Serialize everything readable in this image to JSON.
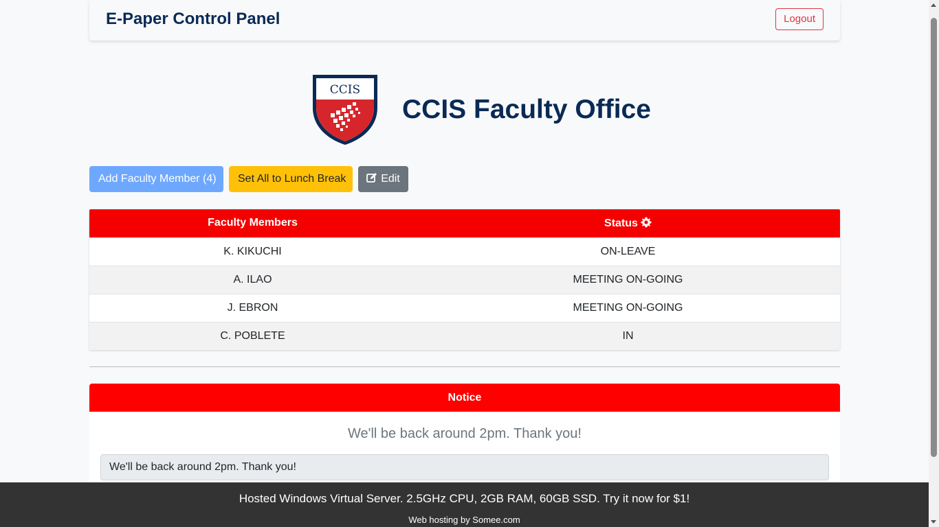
{
  "navbar": {
    "brand": "E-Paper Control Panel",
    "logout_label": "Logout"
  },
  "header": {
    "logo_text": "CCIS",
    "title": "CCIS Faculty Office"
  },
  "actions": {
    "add_label": "Add Faculty Member (4)",
    "lunch_label": "Set All to Lunch Break",
    "edit_label": "Edit"
  },
  "faculty_table": {
    "columns": [
      "Faculty Members",
      "Status"
    ],
    "rows": [
      {
        "name": "K. KIKUCHI",
        "status": "ON-LEAVE"
      },
      {
        "name": "A. ILAO",
        "status": "MEETING ON-GOING"
      },
      {
        "name": "J. EBRON",
        "status": "MEETING ON-GOING"
      },
      {
        "name": "C. POBLETE",
        "status": "IN"
      }
    ]
  },
  "notice": {
    "header": "Notice",
    "message": "We'll be back around 2pm. Thank you!",
    "input_value": "We'll be back around 2pm. Thank you!"
  },
  "footer": {
    "ad_text": "Hosted Windows Virtual Server. 2.5GHz CPU, 2GB RAM, 60GB SSD. Try it now for $1!",
    "hosting_text": "Web hosting by Somee.com"
  },
  "colors": {
    "brand_navy": "#0a2a55",
    "table_header_red": "#f50000",
    "primary_light": "#6ea8fe",
    "warning": "#ffc107",
    "secondary": "#6c757d",
    "danger": "#dc3545"
  }
}
